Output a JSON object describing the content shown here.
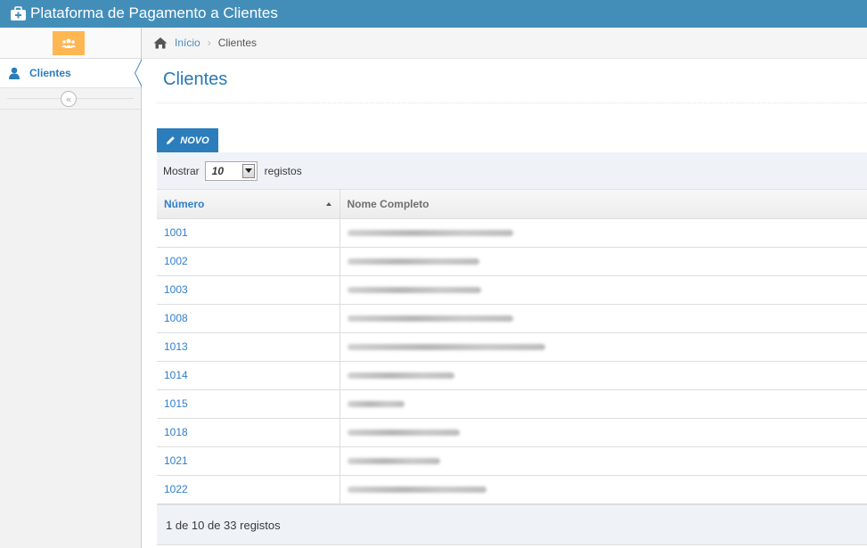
{
  "app": {
    "title": "Plataforma de Pagamento a Clientes",
    "accent": "#438eb9"
  },
  "sidebar": {
    "shortcut_icon": "users-icon",
    "items": [
      {
        "label": "Clientes",
        "icon": "user-icon"
      }
    ],
    "collapse_glyph": "«"
  },
  "breadcrumb": {
    "home": "Início",
    "current": "Clientes"
  },
  "page": {
    "title": "Clientes"
  },
  "toolbar": {
    "new_label": "NOVO",
    "show_label": "Mostrar",
    "page_size": "10",
    "records_label": "registos"
  },
  "table": {
    "columns": [
      "Número",
      "Nome Completo"
    ],
    "rows": [
      {
        "numero": "1001"
      },
      {
        "numero": "1002"
      },
      {
        "numero": "1003"
      },
      {
        "numero": "1008"
      },
      {
        "numero": "1013"
      },
      {
        "numero": "1014"
      },
      {
        "numero": "1015"
      },
      {
        "numero": "1018"
      },
      {
        "numero": "1021"
      },
      {
        "numero": "1022"
      }
    ]
  },
  "pagination": {
    "summary": "1 de 10 de 33 registos"
  }
}
